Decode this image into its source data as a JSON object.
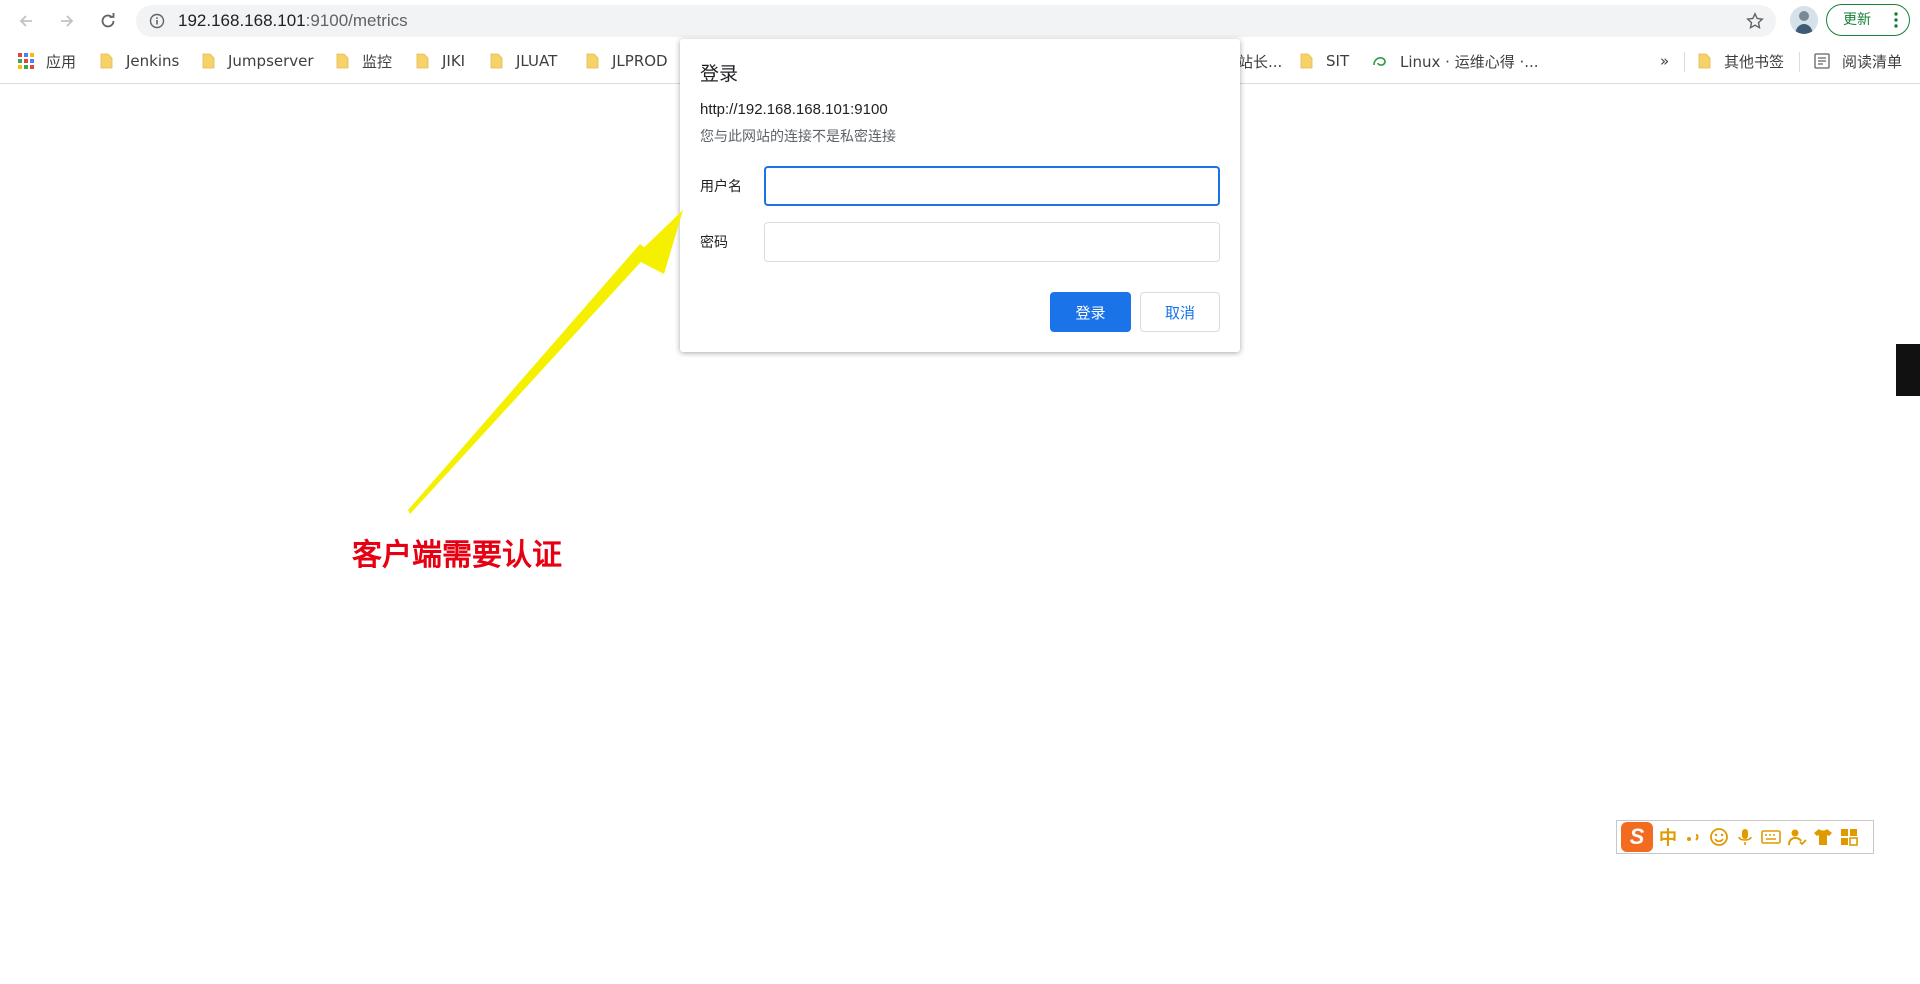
{
  "browser": {
    "url_host": "192.168.168.101",
    "url_path": ":9100/metrics",
    "update_label": "更新"
  },
  "bookmarks": [
    {
      "label": "应用"
    },
    {
      "label": "Jenkins"
    },
    {
      "label": "Jumpserver"
    },
    {
      "label": "监控"
    },
    {
      "label": "JIKI"
    },
    {
      "label": "JLUAT"
    },
    {
      "label": "JLPROD"
    },
    {
      "label": "站长..."
    },
    {
      "label": "SIT"
    },
    {
      "label": "Linux · 运维心得 ·..."
    }
  ],
  "bookmarks_more": "»",
  "bookmarks_other": "其他书签",
  "reading_list": "阅读清单",
  "dialog": {
    "title": "登录",
    "origin": "http://192.168.168.101:9100",
    "warning": "您与此网站的连接不是私密连接",
    "username_label": "用户名",
    "username_value": "",
    "password_label": "密码",
    "password_value": "",
    "login_label": "登录",
    "cancel_label": "取消"
  },
  "annotation": {
    "text": "客户端需要认证",
    "color": "#e60012",
    "arrow_color": "#f5f000"
  },
  "ime": {
    "logo": "S",
    "mode": "中"
  },
  "colors": {
    "accent": "#1a73e8",
    "update_green": "#188038",
    "folder": "#f6d36a"
  }
}
